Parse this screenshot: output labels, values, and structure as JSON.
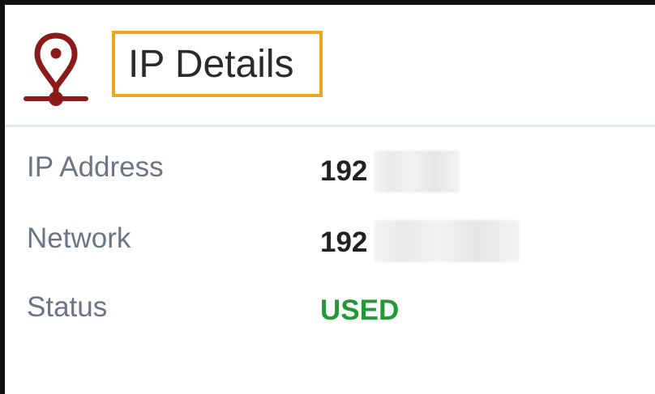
{
  "header": {
    "title": "IP Details",
    "icon": "map-pin-icon",
    "icon_color": "#8b1a1a",
    "highlight_color": "#f0a51e"
  },
  "details": {
    "rows": [
      {
        "label": "IP Address",
        "value": "192"
      },
      {
        "label": "Network",
        "value": "192"
      },
      {
        "label": "Status",
        "value": "USED",
        "value_color": "#1f9a34"
      }
    ]
  }
}
